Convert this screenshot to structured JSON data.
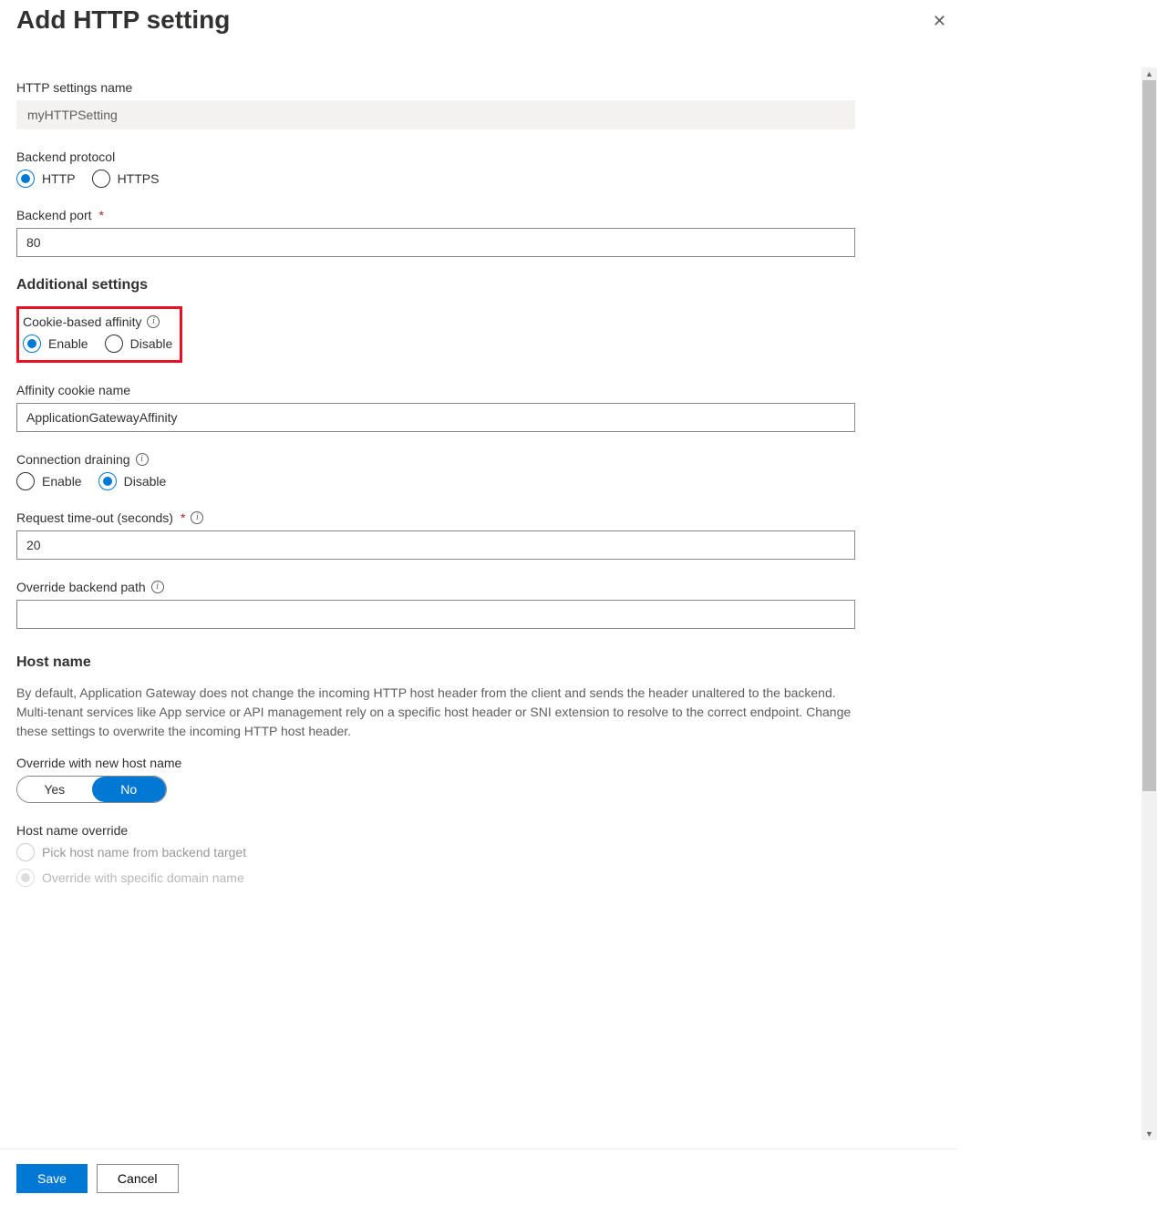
{
  "title": "Add HTTP setting",
  "fields": {
    "settings_name": {
      "label": "HTTP settings name",
      "value": "myHTTPSetting"
    },
    "backend_protocol": {
      "label": "Backend protocol",
      "options": {
        "http": "HTTP",
        "https": "HTTPS"
      },
      "selected": "http"
    },
    "backend_port": {
      "label": "Backend port",
      "value": "80"
    },
    "cookie_affinity": {
      "label": "Cookie-based affinity",
      "options": {
        "enable": "Enable",
        "disable": "Disable"
      },
      "selected": "enable"
    },
    "affinity_cookie_name": {
      "label": "Affinity cookie name",
      "value": "ApplicationGatewayAffinity"
    },
    "connection_draining": {
      "label": "Connection draining",
      "options": {
        "enable": "Enable",
        "disable": "Disable"
      },
      "selected": "disable"
    },
    "request_timeout": {
      "label": "Request time-out (seconds)",
      "value": "20"
    },
    "override_backend_path": {
      "label": "Override backend path",
      "value": ""
    },
    "override_host_name": {
      "label": "Override with new host name",
      "options": {
        "yes": "Yes",
        "no": "No"
      },
      "selected": "no"
    },
    "host_name_override": {
      "label": "Host name override",
      "options": {
        "pick": "Pick host name from backend target",
        "specific": "Override with specific domain name"
      },
      "selected": "specific"
    }
  },
  "sections": {
    "additional": "Additional settings",
    "host_name": "Host name"
  },
  "host_name_desc": "By default, Application Gateway does not change the incoming HTTP host header from the client and sends the header unaltered to the backend. Multi-tenant services like App service or API management rely on a specific host header or SNI extension to resolve to the correct endpoint. Change these settings to overwrite the incoming HTTP host header.",
  "footer": {
    "save": "Save",
    "cancel": "Cancel"
  }
}
